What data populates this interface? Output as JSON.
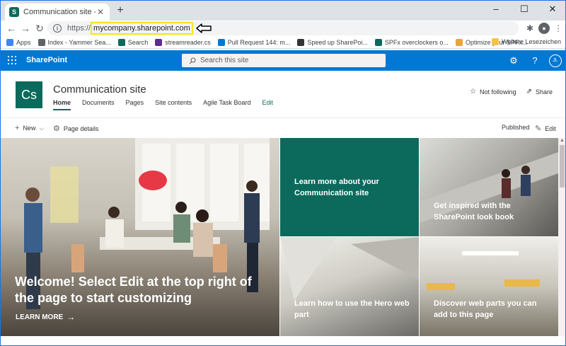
{
  "browser": {
    "tab_title": "Communication site - Home",
    "tab_favicon_letter": "S",
    "new_tab": "+",
    "url_scheme": "https://",
    "url_host": "mycompany.sharepoint.com",
    "controls": {
      "minimize": "–",
      "maximize": "☐",
      "close": "✕"
    }
  },
  "bookmarks": {
    "items": [
      {
        "label": "Apps",
        "icon": "apps-grid-icon",
        "color": "#4285f4"
      },
      {
        "label": "Index - Yammer Sea...",
        "icon": "yammer-icon",
        "color": "#5f6368"
      },
      {
        "label": "Search",
        "icon": "sharepoint-icon",
        "color": "#0b6a5c"
      },
      {
        "label": "streamreader.cs",
        "icon": "visualstudio-icon",
        "color": "#5c2d91"
      },
      {
        "label": "Pull Request 144: m...",
        "icon": "devops-icon",
        "color": "#0078d4"
      },
      {
        "label": "Speed up SharePoi...",
        "icon": "pin-icon",
        "color": "#333333"
      },
      {
        "label": "SPFx overclockers o...",
        "icon": "spfx-icon",
        "color": "#0b6a5c"
      },
      {
        "label": "Optimize your SPFx...",
        "icon": "blog-icon",
        "color": "#e8a33d"
      }
    ],
    "other": "Weitere Lesezeichen"
  },
  "suitebar": {
    "brand": "SharePoint",
    "search_placeholder": "Search this site",
    "avatar_initials": "JL"
  },
  "site": {
    "logo_initials": "Cs",
    "title": "Communication site",
    "nav": [
      "Home",
      "Documents",
      "Pages",
      "Site contents",
      "Agile Task Board",
      "Edit"
    ],
    "follow": "Not following",
    "share": "Share"
  },
  "commandbar": {
    "new": "New",
    "page_details": "Page details",
    "status": "Published",
    "edit": "Edit"
  },
  "hero": {
    "main_title": "Welcome! Select Edit at the top right of the page to start customizing",
    "main_link": "LEARN MORE",
    "tiles": [
      "Learn more about your Communication site",
      "Get inspired with the SharePoint look book",
      "Learn how to use the Hero web part",
      "Discover web parts you can add to this page"
    ]
  },
  "colors": {
    "brand": "#0078d4",
    "theme": "#0b6a5c",
    "url_highlight": "#ffe11a"
  }
}
